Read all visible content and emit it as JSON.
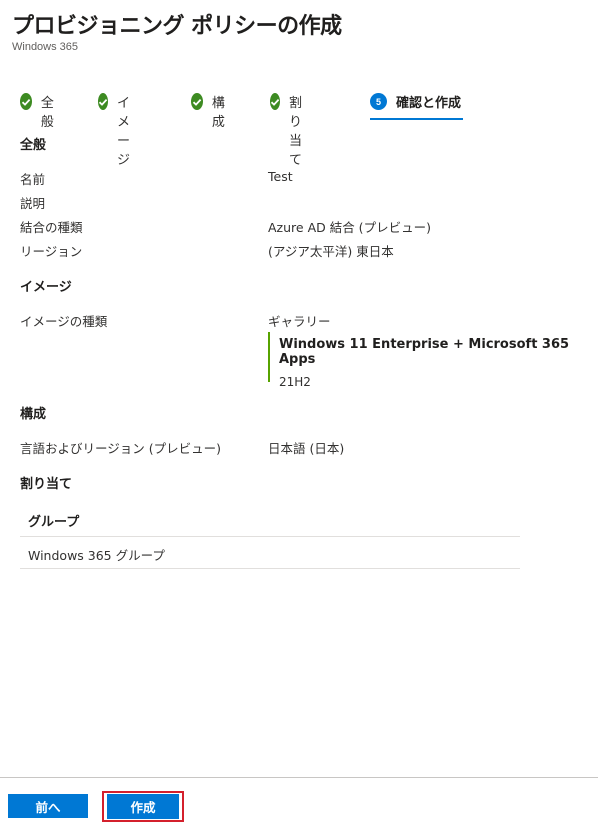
{
  "header": {
    "title": "プロビジョニング ポリシーの作成",
    "more": "…",
    "subtitle": "Windows 365"
  },
  "steps": [
    {
      "label": "全般",
      "status": "complete",
      "icon": "check-circle-icon"
    },
    {
      "label": "イメージ",
      "status": "complete",
      "icon": "check-circle-icon"
    },
    {
      "label": "構成",
      "status": "complete",
      "icon": "check-circle-icon"
    },
    {
      "label": "割り当て",
      "status": "complete",
      "icon": "check-circle-icon"
    },
    {
      "label": "確認と作成",
      "status": "active",
      "number": "5"
    }
  ],
  "general": {
    "title": "全般",
    "name_label": "名前",
    "name_value": "Test",
    "description_label": "説明",
    "join_type_label": "結合の種類",
    "join_type_value": "Azure AD 結合 (プレビュー)",
    "region_label": "リージョン",
    "region_value": "(アジア太平洋) 東日本"
  },
  "image": {
    "title": "イメージ",
    "type_label": "イメージの種類",
    "type_value": "ギャラリー",
    "name": "Windows 11 Enterprise + Microsoft 365 Apps",
    "version": "21H2"
  },
  "configuration": {
    "title": "構成",
    "lang_label": "言語およびリージョン (プレビュー)",
    "lang_value": "日本語 (日本)"
  },
  "assignments": {
    "title": "割り当て",
    "column_header": "グループ",
    "rows": [
      "Windows 365 グループ"
    ]
  },
  "footer": {
    "back_label": "前へ",
    "create_label": "作成"
  },
  "colors": {
    "accent": "#0078d4",
    "complete": "#3d8b22",
    "highlight_border": "#d4202c",
    "image_card_border": "#57a300"
  }
}
